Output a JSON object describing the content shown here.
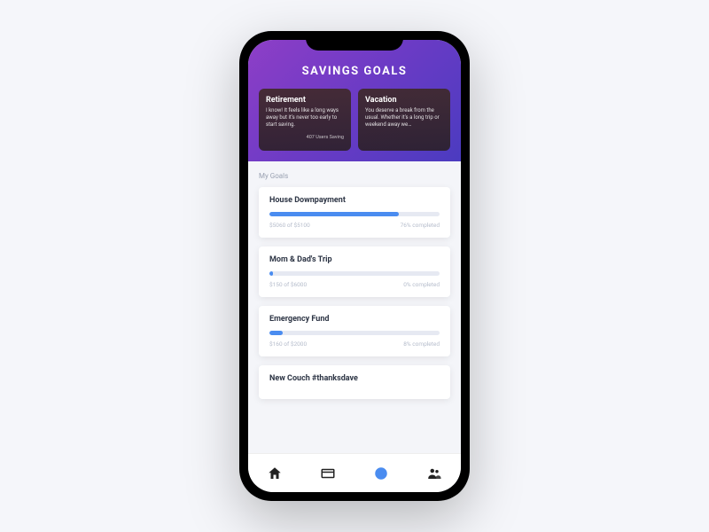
{
  "header": {
    "title": "SAVINGS GOALS"
  },
  "suggestions": [
    {
      "title": "Retirement",
      "desc": "I know! It feels like a long ways away but it's never too early to start saving.",
      "stats": "407 Users Saving"
    },
    {
      "title": "Vacation",
      "desc": "You deserve a break from the usual. Whether it's a long trip or weekend away we…",
      "stats": ""
    }
  ],
  "section_label": "My Goals",
  "goals": [
    {
      "title": "House Downpayment",
      "saved": "$5060",
      "target": "$5100",
      "percent": 76,
      "percent_label": "76% completed"
    },
    {
      "title": "Mom & Dad's Trip",
      "saved": "$150",
      "target": "$6000",
      "percent": 2,
      "percent_label": "0% completed"
    },
    {
      "title": "Emergency Fund",
      "saved": "$160",
      "target": "$2000",
      "percent": 8,
      "percent_label": "8% completed"
    },
    {
      "title": "New Couch #thanksdave",
      "saved": "",
      "target": "",
      "percent": 0,
      "percent_label": ""
    }
  ],
  "tabs": {
    "home": "home-icon",
    "card": "card-icon",
    "goals": "target-icon",
    "people": "people-icon"
  },
  "colors": {
    "accent": "#4a8cf0",
    "header_gradient_start": "#8e3ec7",
    "header_gradient_end": "#4b3bc0"
  }
}
